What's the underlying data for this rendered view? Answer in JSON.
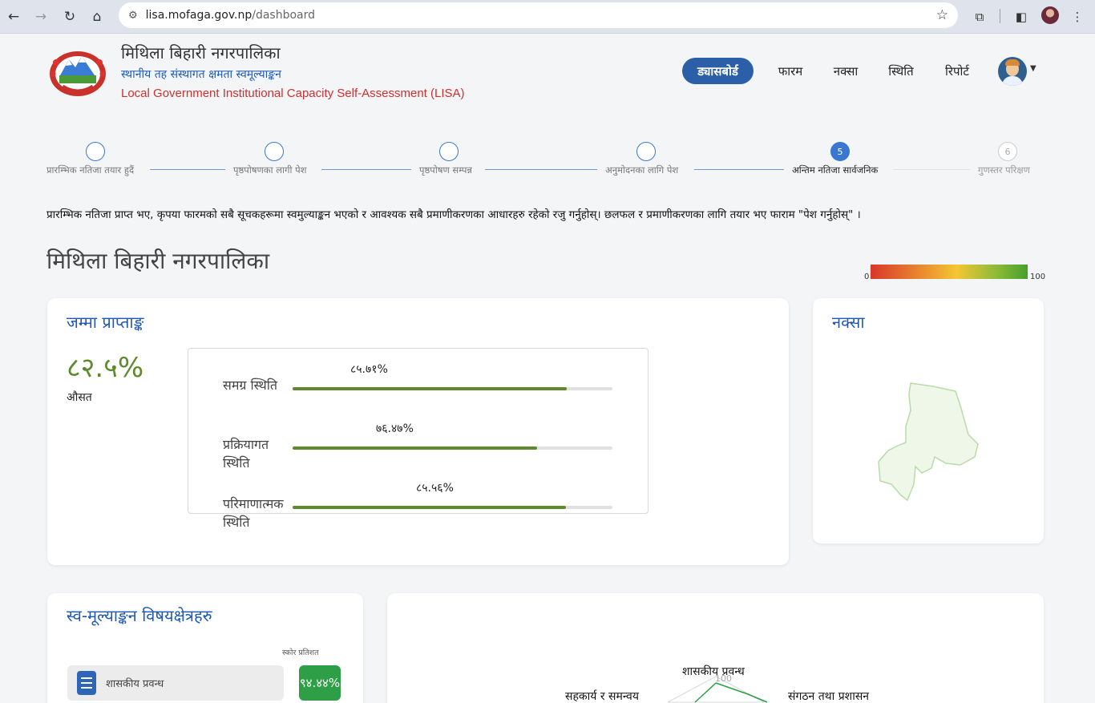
{
  "browser": {
    "url_host": "lisa.mofaga.gov.np",
    "url_path": "/dashboard"
  },
  "header": {
    "title": "मिथिला बिहारी नगरपालिका",
    "subtitle_np": "स्थानीय तह संस्थागत क्षमता स्वमूल्याङ्कन",
    "subtitle_en": "Local Government Institutional Capacity Self-Assessment (LISA)",
    "nav": {
      "dashboard": "ड्यासबोर्ड",
      "form": "फारम",
      "map": "नक्सा",
      "status": "स्थिति",
      "report": "रिपोर्ट"
    }
  },
  "stepper": {
    "steps": [
      {
        "label": "प्रारम्भिक नतिजा तयार हुदैं",
        "number": ""
      },
      {
        "label": "पृष्ठपोषणका लागी पेश",
        "number": ""
      },
      {
        "label": "पृष्ठपोषण सम्पन्न",
        "number": ""
      },
      {
        "label": "अनुमोदनका लागि पेश",
        "number": ""
      },
      {
        "label": "अन्तिम नतिजा सार्वजनिक",
        "number": "5"
      },
      {
        "label": "गुणस्तर परिक्षण",
        "number": "6"
      }
    ]
  },
  "notice": "प्रारम्भिक नतिजा प्राप्त भए, कृपया फारमको सबै सूचकहरूमा स्वमुल्याङ्कन भएको र आवश्यक सबै प्रमाणीकरणका आधारहरु रहेको रजु गर्नुहोस्। छलफल र प्रमाणीकरणका लागि तयार भए फाराम \"पेश गर्नुहोस्\" ।",
  "org_heading": "मिथिला बिहारी नगरपालिका",
  "scale": {
    "min": "0",
    "max": "100"
  },
  "total_score": {
    "title": "जम्मा प्राप्ताङ्क",
    "value": "८२.५%",
    "sub": "औसत",
    "bars": [
      {
        "label": "समग्र स्थिति",
        "value_text": "८५.७१%",
        "value": 85.71
      },
      {
        "label": "प्रक्रियागत स्थिति",
        "value_text": "७६.४७%",
        "value": 76.47
      },
      {
        "label": "परिमाणात्मक स्थिति",
        "value_text": "८५.५६%",
        "value": 85.56
      }
    ]
  },
  "map_card": {
    "title": "नक्सा"
  },
  "self_assessment": {
    "title": "स्व-मूल्याङ्कन विषयक्षेत्रहरु",
    "score_header": "स्कोर प्रतिशत",
    "items": [
      {
        "label": "शासकीय प्रवन्ध",
        "score": "९४.४४%"
      }
    ]
  },
  "radar": {
    "axes": [
      "शासकीय प्रवन्ध",
      "संगठन तथा प्रशासन",
      "सहकार्य र समन्वय"
    ],
    "max_tick": "100"
  },
  "colors": {
    "primary": "#2b5fa8",
    "score_green": "#5e8a2d",
    "badge_green": "#2e9f47"
  }
}
